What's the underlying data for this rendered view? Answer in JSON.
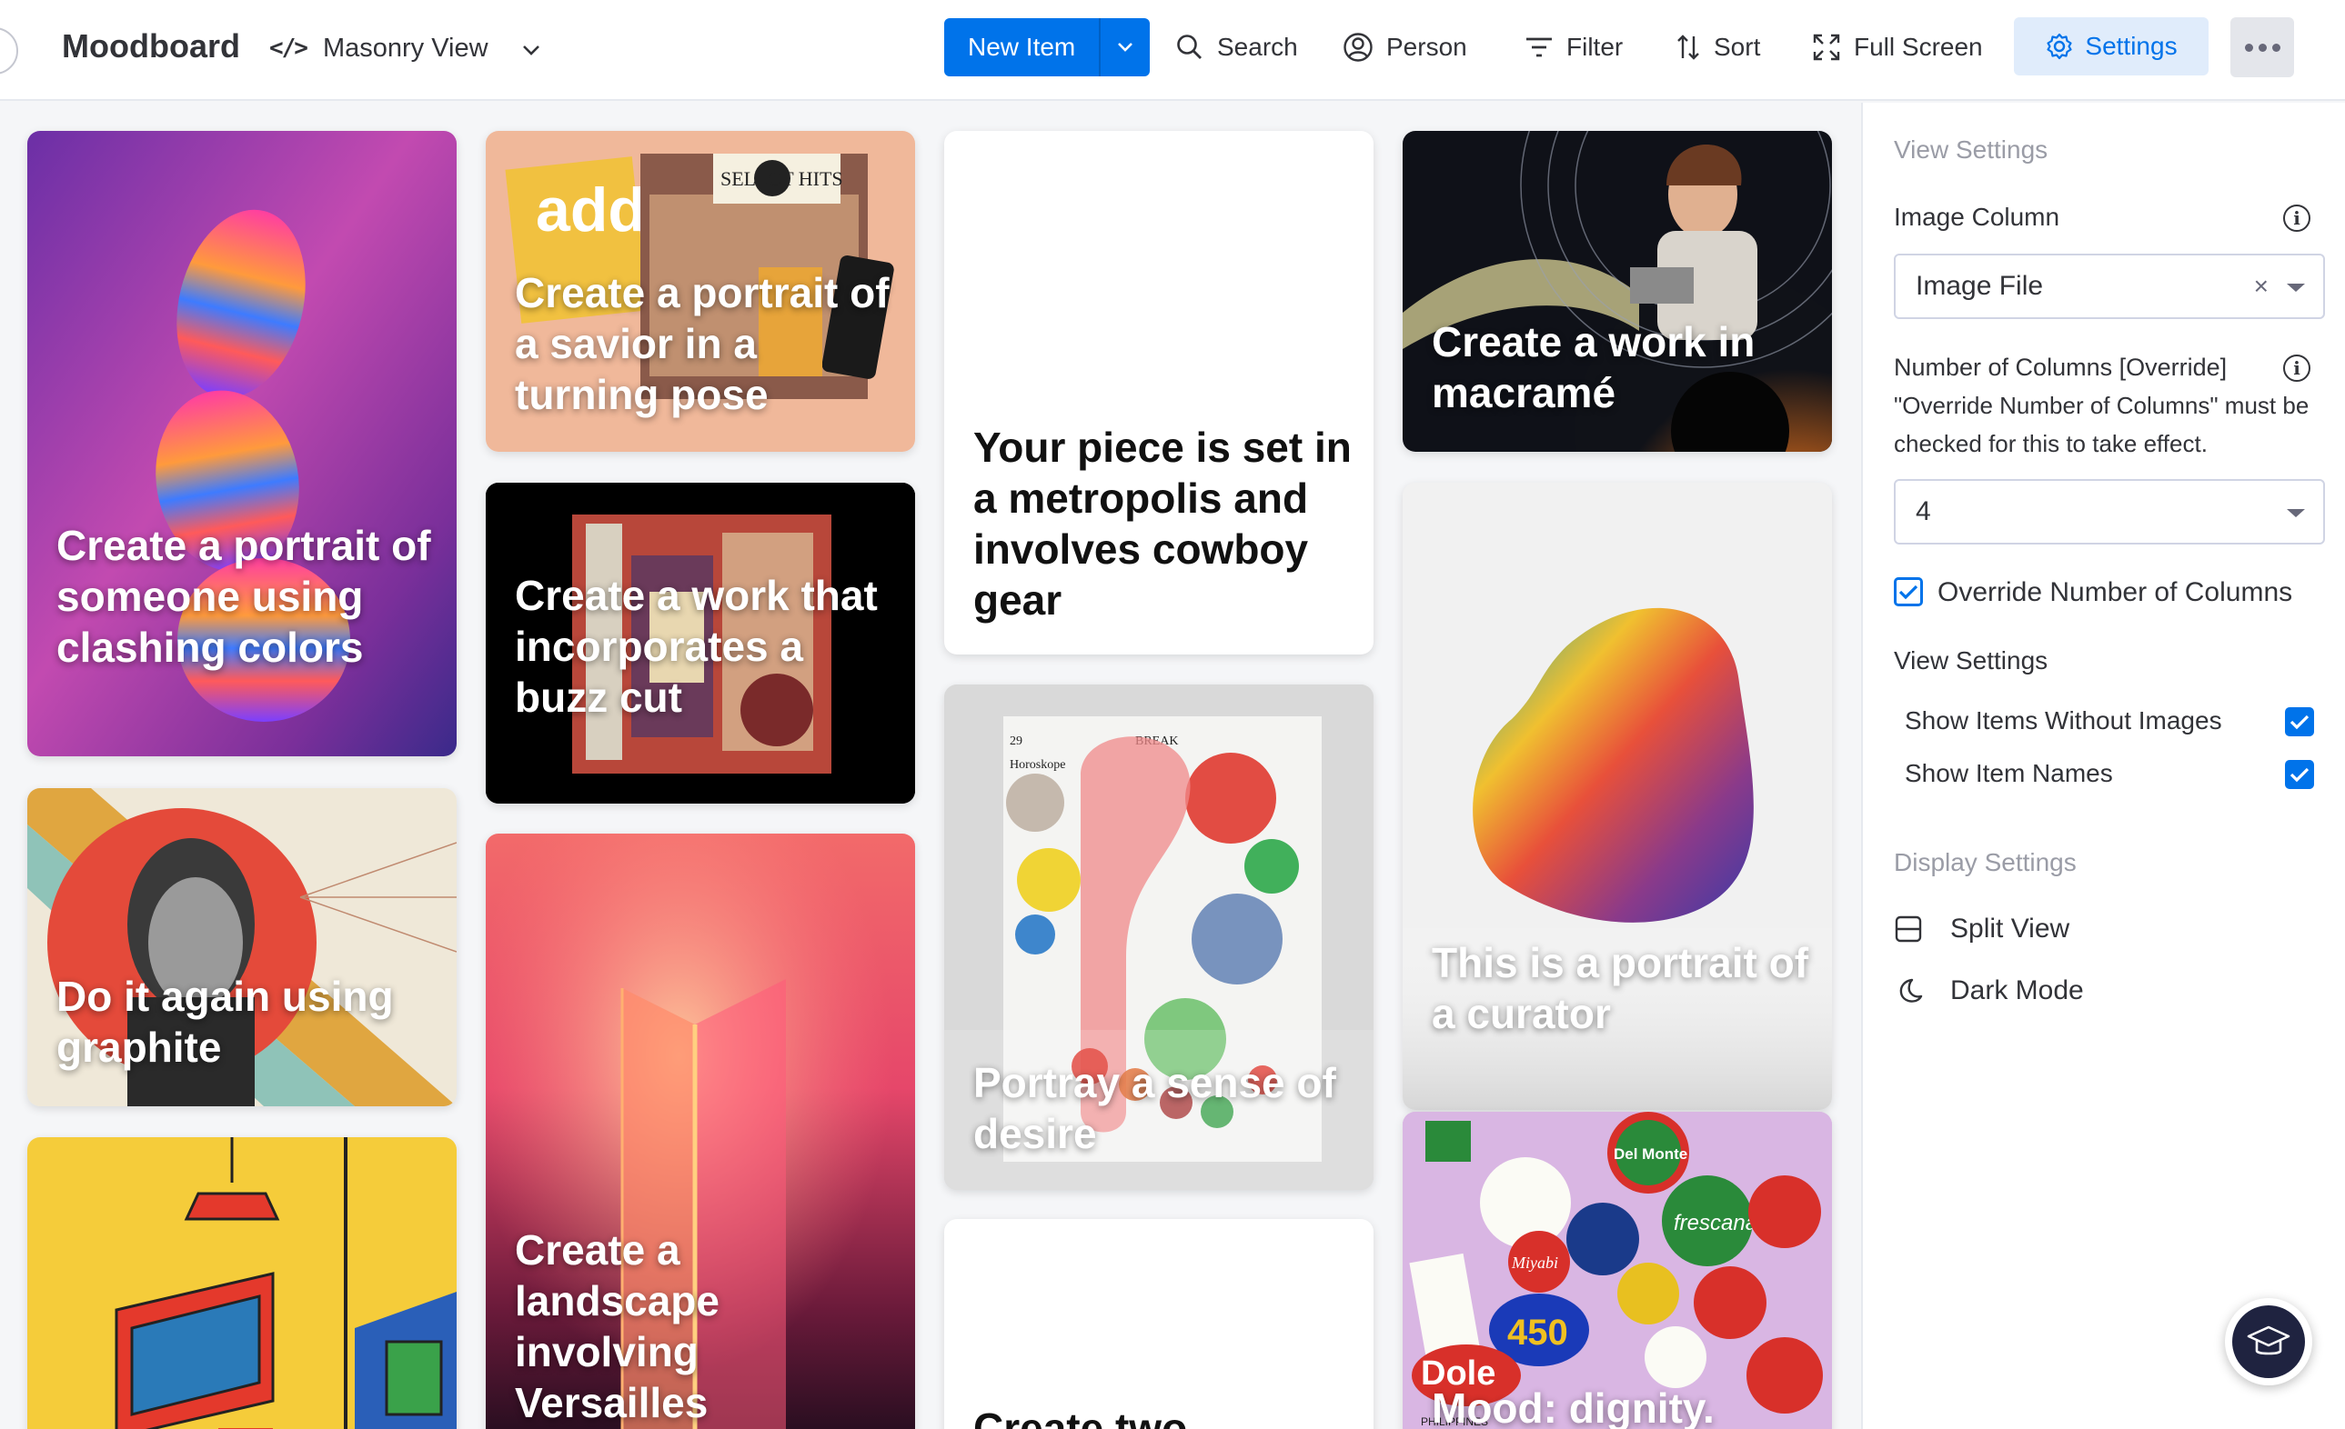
{
  "header": {
    "board_title": "Moodboard",
    "view_name": "Masonry View",
    "new_item_label": "New Item",
    "search_label": "Search",
    "person_label": "Person",
    "filter_label": "Filter",
    "sort_label": "Sort",
    "fullscreen_label": "Full Screen",
    "settings_label": "Settings"
  },
  "cards": [
    {
      "title": "Create a portrait of someone using clashing colors"
    },
    {
      "title": "Do it again using graphite"
    },
    {
      "title": "Create a portrait of a savior in a turning pose"
    },
    {
      "title": "Create a work that incorporates a buzz cut"
    },
    {
      "title": "Create a landscape involving Versailles"
    },
    {
      "title": "Your piece is set in a metropolis and involves cowboy gear"
    },
    {
      "title": "Portray a sense of desire"
    },
    {
      "title": "Create two"
    },
    {
      "title": "Create a work in macramé"
    },
    {
      "title": "This is a portrait of a curator"
    },
    {
      "title": "Mood: dignity. Theme: snacks"
    }
  ],
  "art_text": {
    "record_sign": "SELECT HITS",
    "add_sign": "add",
    "newspaper_page": "29",
    "newspaper_section": "BREAK",
    "newspaper_heading": "Horoskope",
    "sticker_delmonte": "Del Monte",
    "sticker_frescana": "frescana",
    "sticker_dole": "Dole",
    "sticker_miyabi": "Miyabi",
    "sticker_450": "450",
    "sticker_philippines": "PHILIPPINES"
  },
  "panel": {
    "heading": "View Settings",
    "image_column_label": "Image Column",
    "image_column_value": "Image File",
    "clear_symbol": "×",
    "columns_label": "Number of Columns [Override]",
    "columns_note": "\"Override Number of Columns\" must be checked for this to take effect.",
    "columns_value": "4",
    "override_label": "Override Number of Columns",
    "override_checked": true,
    "view_settings_label": "View Settings",
    "show_without_images_label": "Show Items Without Images",
    "show_without_images_checked": true,
    "show_item_names_label": "Show Item Names",
    "show_item_names_checked": true,
    "display_settings_label": "Display Settings",
    "split_view_label": "Split View",
    "dark_mode_label": "Dark Mode",
    "info_symbol": "i"
  },
  "colors": {
    "accent": "#0073ea",
    "accent_soft": "#e0ecfb",
    "text": "#323338",
    "muted": "#9a9ca6"
  }
}
